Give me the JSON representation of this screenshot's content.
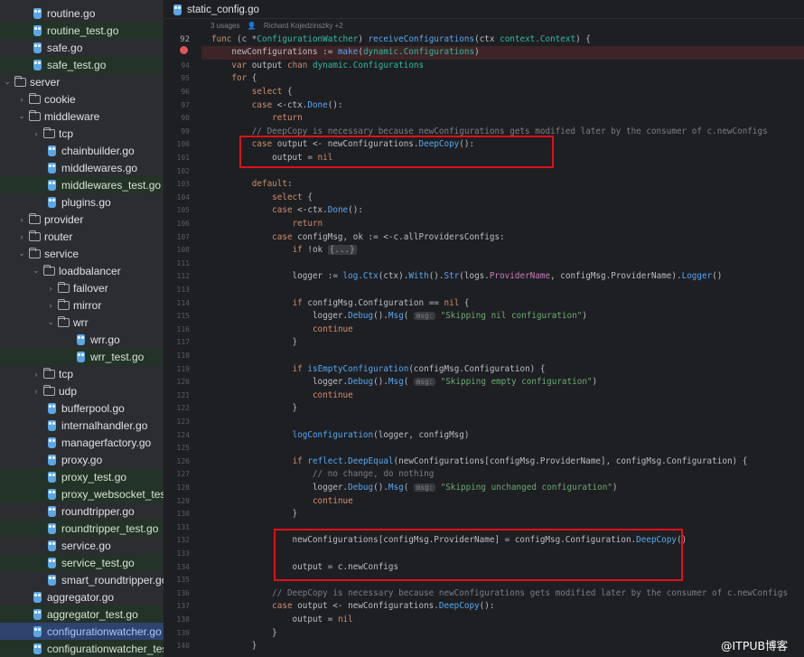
{
  "tree": [
    {
      "label": "routine.go",
      "depth": 2,
      "kind": "go",
      "test": false
    },
    {
      "label": "routine_test.go",
      "depth": 2,
      "kind": "go",
      "test": true
    },
    {
      "label": "safe.go",
      "depth": 2,
      "kind": "go",
      "test": false
    },
    {
      "label": "safe_test.go",
      "depth": 2,
      "kind": "go",
      "test": true
    },
    {
      "label": "server",
      "depth": 0,
      "kind": "folder",
      "open": true
    },
    {
      "label": "cookie",
      "depth": 1,
      "kind": "folder",
      "open": false
    },
    {
      "label": "middleware",
      "depth": 1,
      "kind": "folder",
      "open": true
    },
    {
      "label": "tcp",
      "depth": 2,
      "kind": "folder",
      "open": false
    },
    {
      "label": "chainbuilder.go",
      "depth": 3,
      "kind": "go",
      "test": false
    },
    {
      "label": "middlewares.go",
      "depth": 3,
      "kind": "go",
      "test": false
    },
    {
      "label": "middlewares_test.go",
      "depth": 3,
      "kind": "go",
      "test": true
    },
    {
      "label": "plugins.go",
      "depth": 3,
      "kind": "go",
      "test": false
    },
    {
      "label": "provider",
      "depth": 1,
      "kind": "folder",
      "open": false
    },
    {
      "label": "router",
      "depth": 1,
      "kind": "folder",
      "open": false
    },
    {
      "label": "service",
      "depth": 1,
      "kind": "folder",
      "open": true
    },
    {
      "label": "loadbalancer",
      "depth": 2,
      "kind": "folder",
      "open": true
    },
    {
      "label": "failover",
      "depth": 3,
      "kind": "folder",
      "open": false
    },
    {
      "label": "mirror",
      "depth": 3,
      "kind": "folder",
      "open": false
    },
    {
      "label": "wrr",
      "depth": 3,
      "kind": "folder",
      "open": true
    },
    {
      "label": "wrr.go",
      "depth": 5,
      "kind": "go",
      "test": false
    },
    {
      "label": "wrr_test.go",
      "depth": 5,
      "kind": "go",
      "test": true
    },
    {
      "label": "tcp",
      "depth": 2,
      "kind": "folder",
      "open": false
    },
    {
      "label": "udp",
      "depth": 2,
      "kind": "folder",
      "open": false
    },
    {
      "label": "bufferpool.go",
      "depth": 3,
      "kind": "go",
      "test": false
    },
    {
      "label": "internalhandler.go",
      "depth": 3,
      "kind": "go",
      "test": false
    },
    {
      "label": "managerfactory.go",
      "depth": 3,
      "kind": "go",
      "test": false
    },
    {
      "label": "proxy.go",
      "depth": 3,
      "kind": "go",
      "test": false
    },
    {
      "label": "proxy_test.go",
      "depth": 3,
      "kind": "go",
      "test": true
    },
    {
      "label": "proxy_websocket_test",
      "depth": 3,
      "kind": "go",
      "test": true
    },
    {
      "label": "roundtripper.go",
      "depth": 3,
      "kind": "go",
      "test": false
    },
    {
      "label": "roundtripper_test.go",
      "depth": 3,
      "kind": "go",
      "test": true
    },
    {
      "label": "service.go",
      "depth": 3,
      "kind": "go",
      "test": false
    },
    {
      "label": "service_test.go",
      "depth": 3,
      "kind": "go",
      "test": true
    },
    {
      "label": "smart_roundtripper.go",
      "depth": 3,
      "kind": "go",
      "test": false
    },
    {
      "label": "aggregator.go",
      "depth": 2,
      "kind": "go",
      "test": false
    },
    {
      "label": "aggregator_test.go",
      "depth": 2,
      "kind": "go",
      "test": true
    },
    {
      "label": "configurationwatcher.go",
      "depth": 2,
      "kind": "go",
      "test": false,
      "selected": true
    },
    {
      "label": "configurationwatcher_tes",
      "depth": 2,
      "kind": "go",
      "test": true
    }
  ],
  "editor": {
    "tab_label": "static_config.go",
    "usages": "3 usages",
    "author": "Richard Kojedzinszky +2",
    "lines": [
      {
        "n": "92",
        "t": "<span class=\"kw\">func</span> (c *<span class=\"ty\">ConfigurationWatcher</span>) <span class=\"fn\">receiveConfigurations</span>(ctx <span class=\"ty\">context.Context</span>) {"
      },
      {
        "n": "",
        "t": "    newConfigurations := <span class=\"fn\">make</span>(<span class=\"ty\">dynamic.Configurations</span>)",
        "err": true
      },
      {
        "n": "94",
        "t": "    <span class=\"kw\">var</span> output <span class=\"kw\">chan</span> <span class=\"ty\">dynamic.Configurations</span>"
      },
      {
        "n": "95",
        "t": "    <span class=\"kw\">for</span> {"
      },
      {
        "n": "96",
        "t": "        <span class=\"kw\">select</span> {"
      },
      {
        "n": "97",
        "t": "        <span class=\"kw\">case</span> &lt;-ctx.<span class=\"fn\">Done</span>():"
      },
      {
        "n": "98",
        "t": "            <span class=\"kw\">return</span>"
      },
      {
        "n": "99",
        "t": "        <span class=\"cm\">// DeepCopy is necessary because newConfigurations gets modified later by the consumer of c.newConfigs</span>"
      },
      {
        "n": "100",
        "t": "        <span class=\"kw\">case</span> output &lt;- newConfigurations.<span class=\"fn\">DeepCopy</span>():"
      },
      {
        "n": "101",
        "t": "            output = <span class=\"kw\">nil</span>"
      },
      {
        "n": "102",
        "t": ""
      },
      {
        "n": "103",
        "t": "        <span class=\"kw\">default</span>:"
      },
      {
        "n": "104",
        "t": "            <span class=\"kw\">select</span> {"
      },
      {
        "n": "105",
        "t": "            <span class=\"kw\">case</span> &lt;-ctx.<span class=\"fn\">Done</span>():"
      },
      {
        "n": "106",
        "t": "                <span class=\"kw\">return</span>"
      },
      {
        "n": "107",
        "t": "            <span class=\"kw\">case</span> configMsg, ok := &lt;-c.allProvidersConfigs:"
      },
      {
        "n": "108",
        "t": "                <span class=\"kw\">if</span> !ok <span class=\"fold\">{...}</span>"
      },
      {
        "n": "111",
        "t": ""
      },
      {
        "n": "112",
        "t": "                logger := <span class=\"fn\">log.Ctx</span>(ctx).<span class=\"fn\">With</span>().<span class=\"fn\">Str</span>(logs.<span class=\"fld\">ProviderName</span>, configMsg.ProviderName).<span class=\"fn\">Logger</span>()"
      },
      {
        "n": "113",
        "t": ""
      },
      {
        "n": "114",
        "t": "                <span class=\"kw\">if</span> configMsg.Configuration == <span class=\"kw\">nil</span> {"
      },
      {
        "n": "115",
        "t": "                    logger.<span class=\"fn\">Debug</span>().<span class=\"fn\">Msg</span>( <span class=\"hintp\">msg:</span> <span class=\"str\">\"Skipping nil configuration\"</span>)"
      },
      {
        "n": "116",
        "t": "                    <span class=\"kw\">continue</span>"
      },
      {
        "n": "117",
        "t": "                }"
      },
      {
        "n": "118",
        "t": ""
      },
      {
        "n": "119",
        "t": "                <span class=\"kw\">if</span> <span class=\"fn\">isEmptyConfiguration</span>(configMsg.Configuration) {"
      },
      {
        "n": "120",
        "t": "                    logger.<span class=\"fn\">Debug</span>().<span class=\"fn\">Msg</span>( <span class=\"hintp\">msg:</span> <span class=\"str\">\"Skipping empty configuration\"</span>)"
      },
      {
        "n": "121",
        "t": "                    <span class=\"kw\">continue</span>"
      },
      {
        "n": "122",
        "t": "                }"
      },
      {
        "n": "123",
        "t": ""
      },
      {
        "n": "124",
        "t": "                <span class=\"fn\">logConfiguration</span>(logger, configMsg)"
      },
      {
        "n": "125",
        "t": ""
      },
      {
        "n": "126",
        "t": "                <span class=\"kw\">if</span> <span class=\"fn\">reflect.DeepEqual</span>(newConfigurations[configMsg.ProviderName], configMsg.Configuration) {"
      },
      {
        "n": "127",
        "t": "                    <span class=\"cm\">// no change, do nothing</span>"
      },
      {
        "n": "128",
        "t": "                    logger.<span class=\"fn\">Debug</span>().<span class=\"fn\">Msg</span>( <span class=\"hintp\">msg:</span> <span class=\"str\">\"Skipping unchanged configuration\"</span>)"
      },
      {
        "n": "129",
        "t": "                    <span class=\"kw\">continue</span>"
      },
      {
        "n": "130",
        "t": "                }"
      },
      {
        "n": "131",
        "t": ""
      },
      {
        "n": "132",
        "t": "                newConfigurations[configMsg.ProviderName] = configMsg.Configuration.<span class=\"fn\">DeepCopy</span>()"
      },
      {
        "n": "133",
        "t": ""
      },
      {
        "n": "134",
        "t": "                output = c.newConfigs"
      },
      {
        "n": "135",
        "t": ""
      },
      {
        "n": "136",
        "t": "            <span class=\"cm\">// DeepCopy is necessary because newConfigurations gets modified later by the consumer of c.newConfigs</span>"
      },
      {
        "n": "137",
        "t": "            <span class=\"kw\">case</span> output &lt;- newConfigurations.<span class=\"fn\">DeepCopy</span>():"
      },
      {
        "n": "138",
        "t": "                output = <span class=\"kw\">nil</span>"
      },
      {
        "n": "139",
        "t": "            }"
      },
      {
        "n": "140",
        "t": "        }"
      }
    ]
  },
  "watermark": "@ITPUB博客",
  "colors": {
    "highlight_box": "#e0101a",
    "keyword": "#cf8e6d",
    "function": "#56a8f5",
    "type": "#2fbaa3",
    "string": "#6aab73",
    "comment": "#7a7e85"
  }
}
